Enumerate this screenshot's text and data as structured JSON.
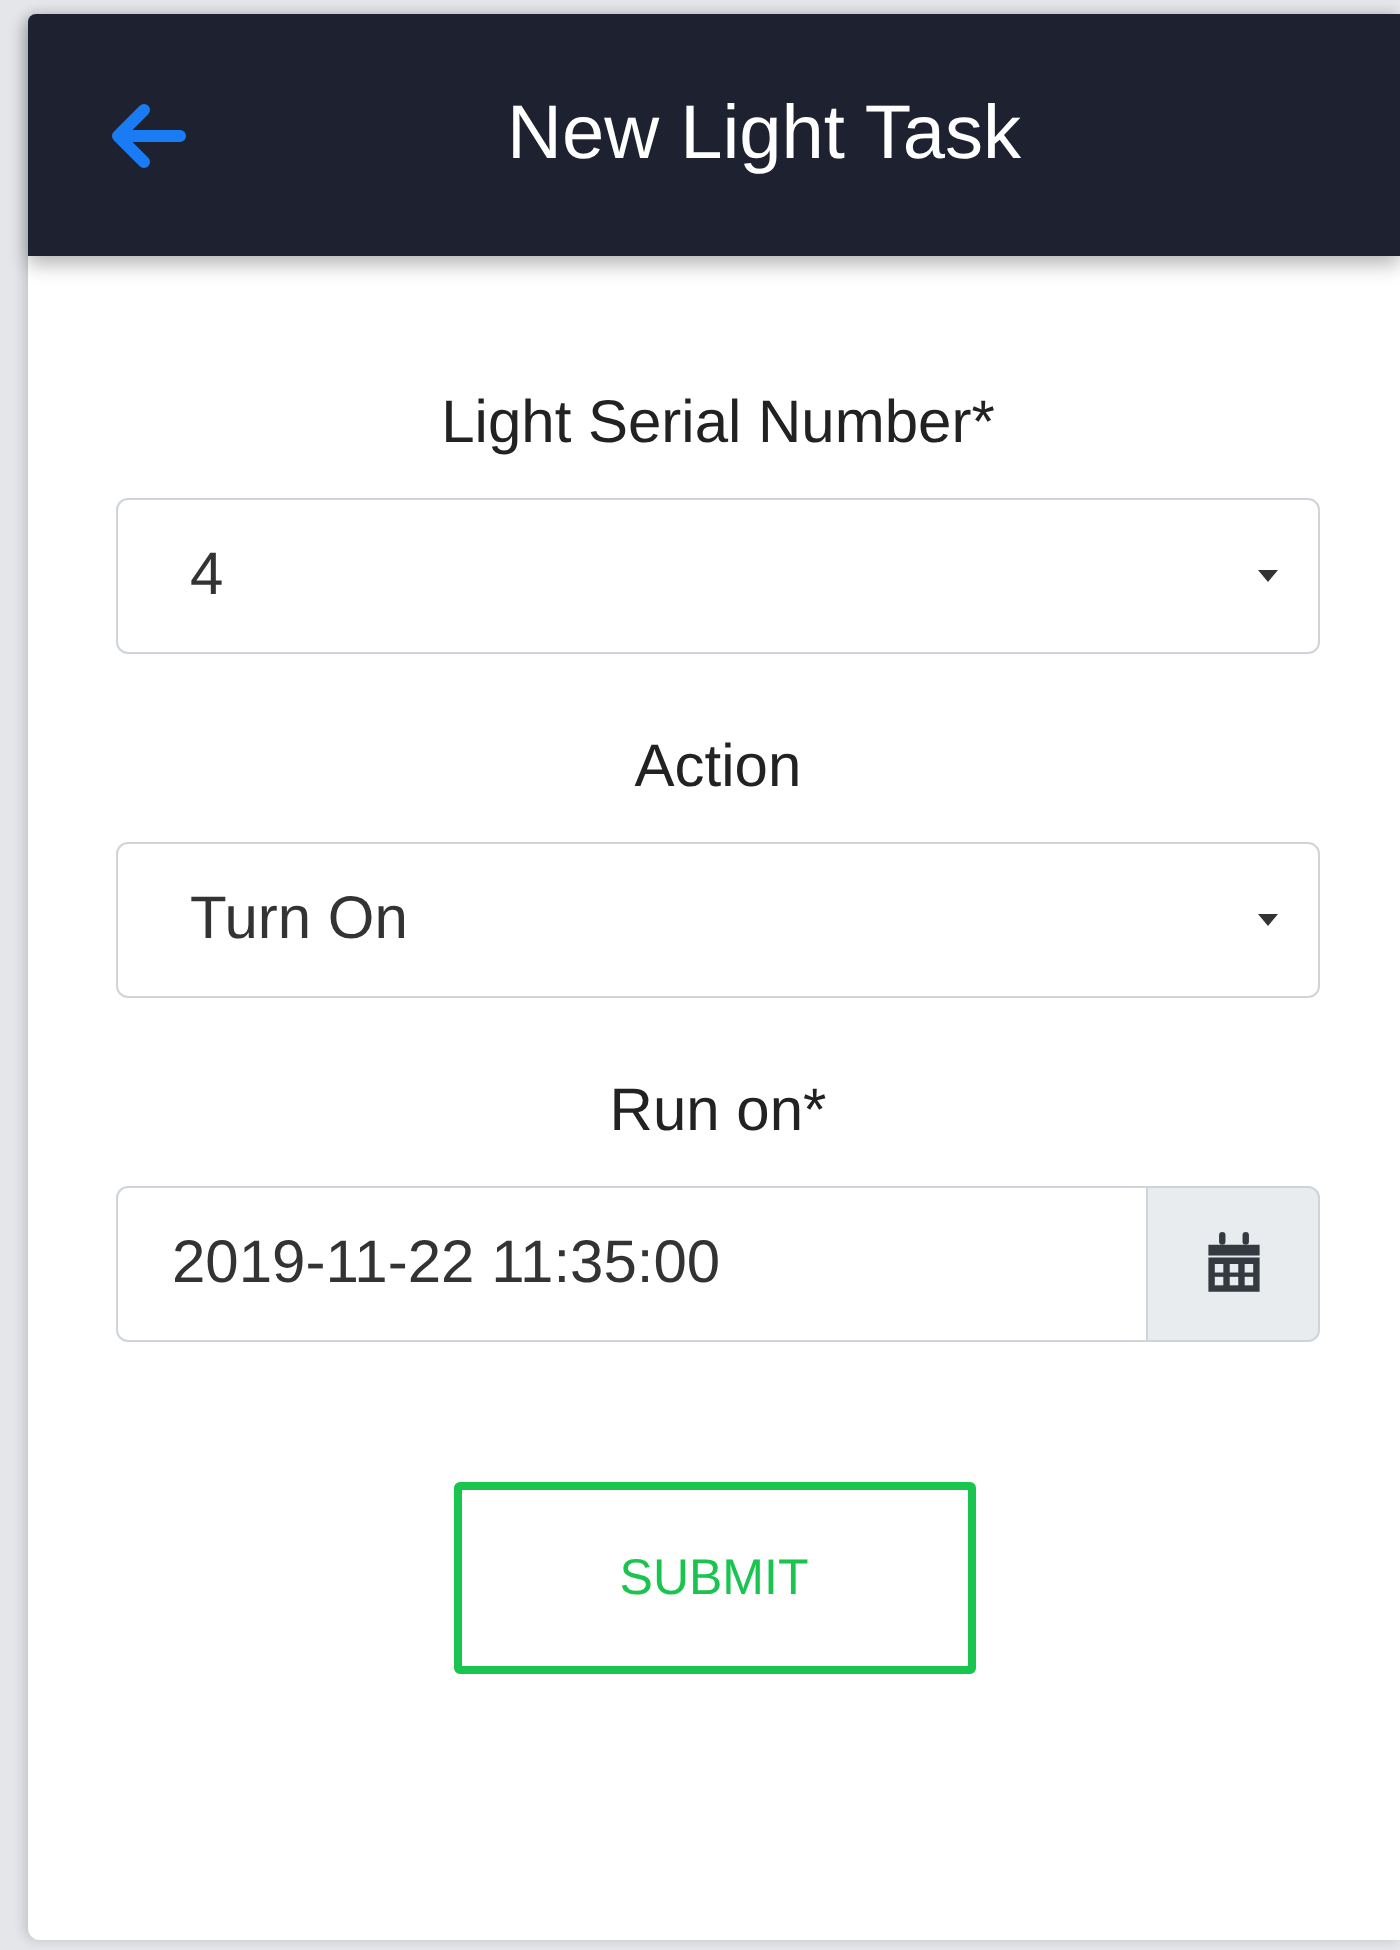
{
  "header": {
    "title": "New Light Task"
  },
  "fields": [
    {
      "kind": "select",
      "label": "Light Serial Number*",
      "value": "4"
    },
    {
      "kind": "select",
      "label": "Action",
      "value": "Turn On"
    },
    {
      "kind": "datetime",
      "label": "Run on*",
      "value": "2019-11-22 11:35:00"
    }
  ],
  "submit": {
    "label": "SUBMIT"
  }
}
